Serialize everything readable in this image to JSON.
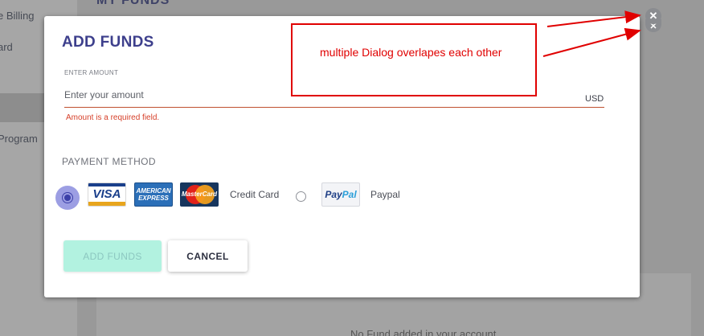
{
  "background": {
    "page_title": "MY FUNDS",
    "sidebar_items": [
      "e Billing",
      "ard",
      "Program"
    ],
    "empty_state": "No Fund added in your account"
  },
  "dialog": {
    "title": "ADD FUNDS",
    "amount_label": "ENTER AMOUNT",
    "amount_placeholder": "Enter your amount",
    "amount_value": "",
    "currency": "USD",
    "error": "Amount is a required field.",
    "payment_method_label": "PAYMENT METHOD",
    "payment_options": [
      {
        "label": "Credit Card",
        "selected": true,
        "logos": [
          "VISA",
          "AMERICAN EXPRESS",
          "MasterCard"
        ]
      },
      {
        "label": "Paypal",
        "selected": false,
        "logos": [
          "PayPal"
        ]
      }
    ],
    "logo_text": {
      "visa": "VISA",
      "amex": "AMERICAN EXPRESS",
      "mastercard": "MasterCard",
      "paypal_pay": "Pay",
      "paypal_pal": "Pal"
    },
    "add_button": "ADD FUNDS",
    "cancel_button": "CANCEL",
    "close_icon": "close-icon",
    "close_glyph": "✕"
  },
  "annotation": {
    "text": "multiple Dialog overlapes each other",
    "color": "#e00000"
  },
  "colors": {
    "accent": "#3d3f8c",
    "error": "#d6402a",
    "add_button_bg": "#b2f2e0",
    "radio_selected": "#9c9ee3"
  }
}
